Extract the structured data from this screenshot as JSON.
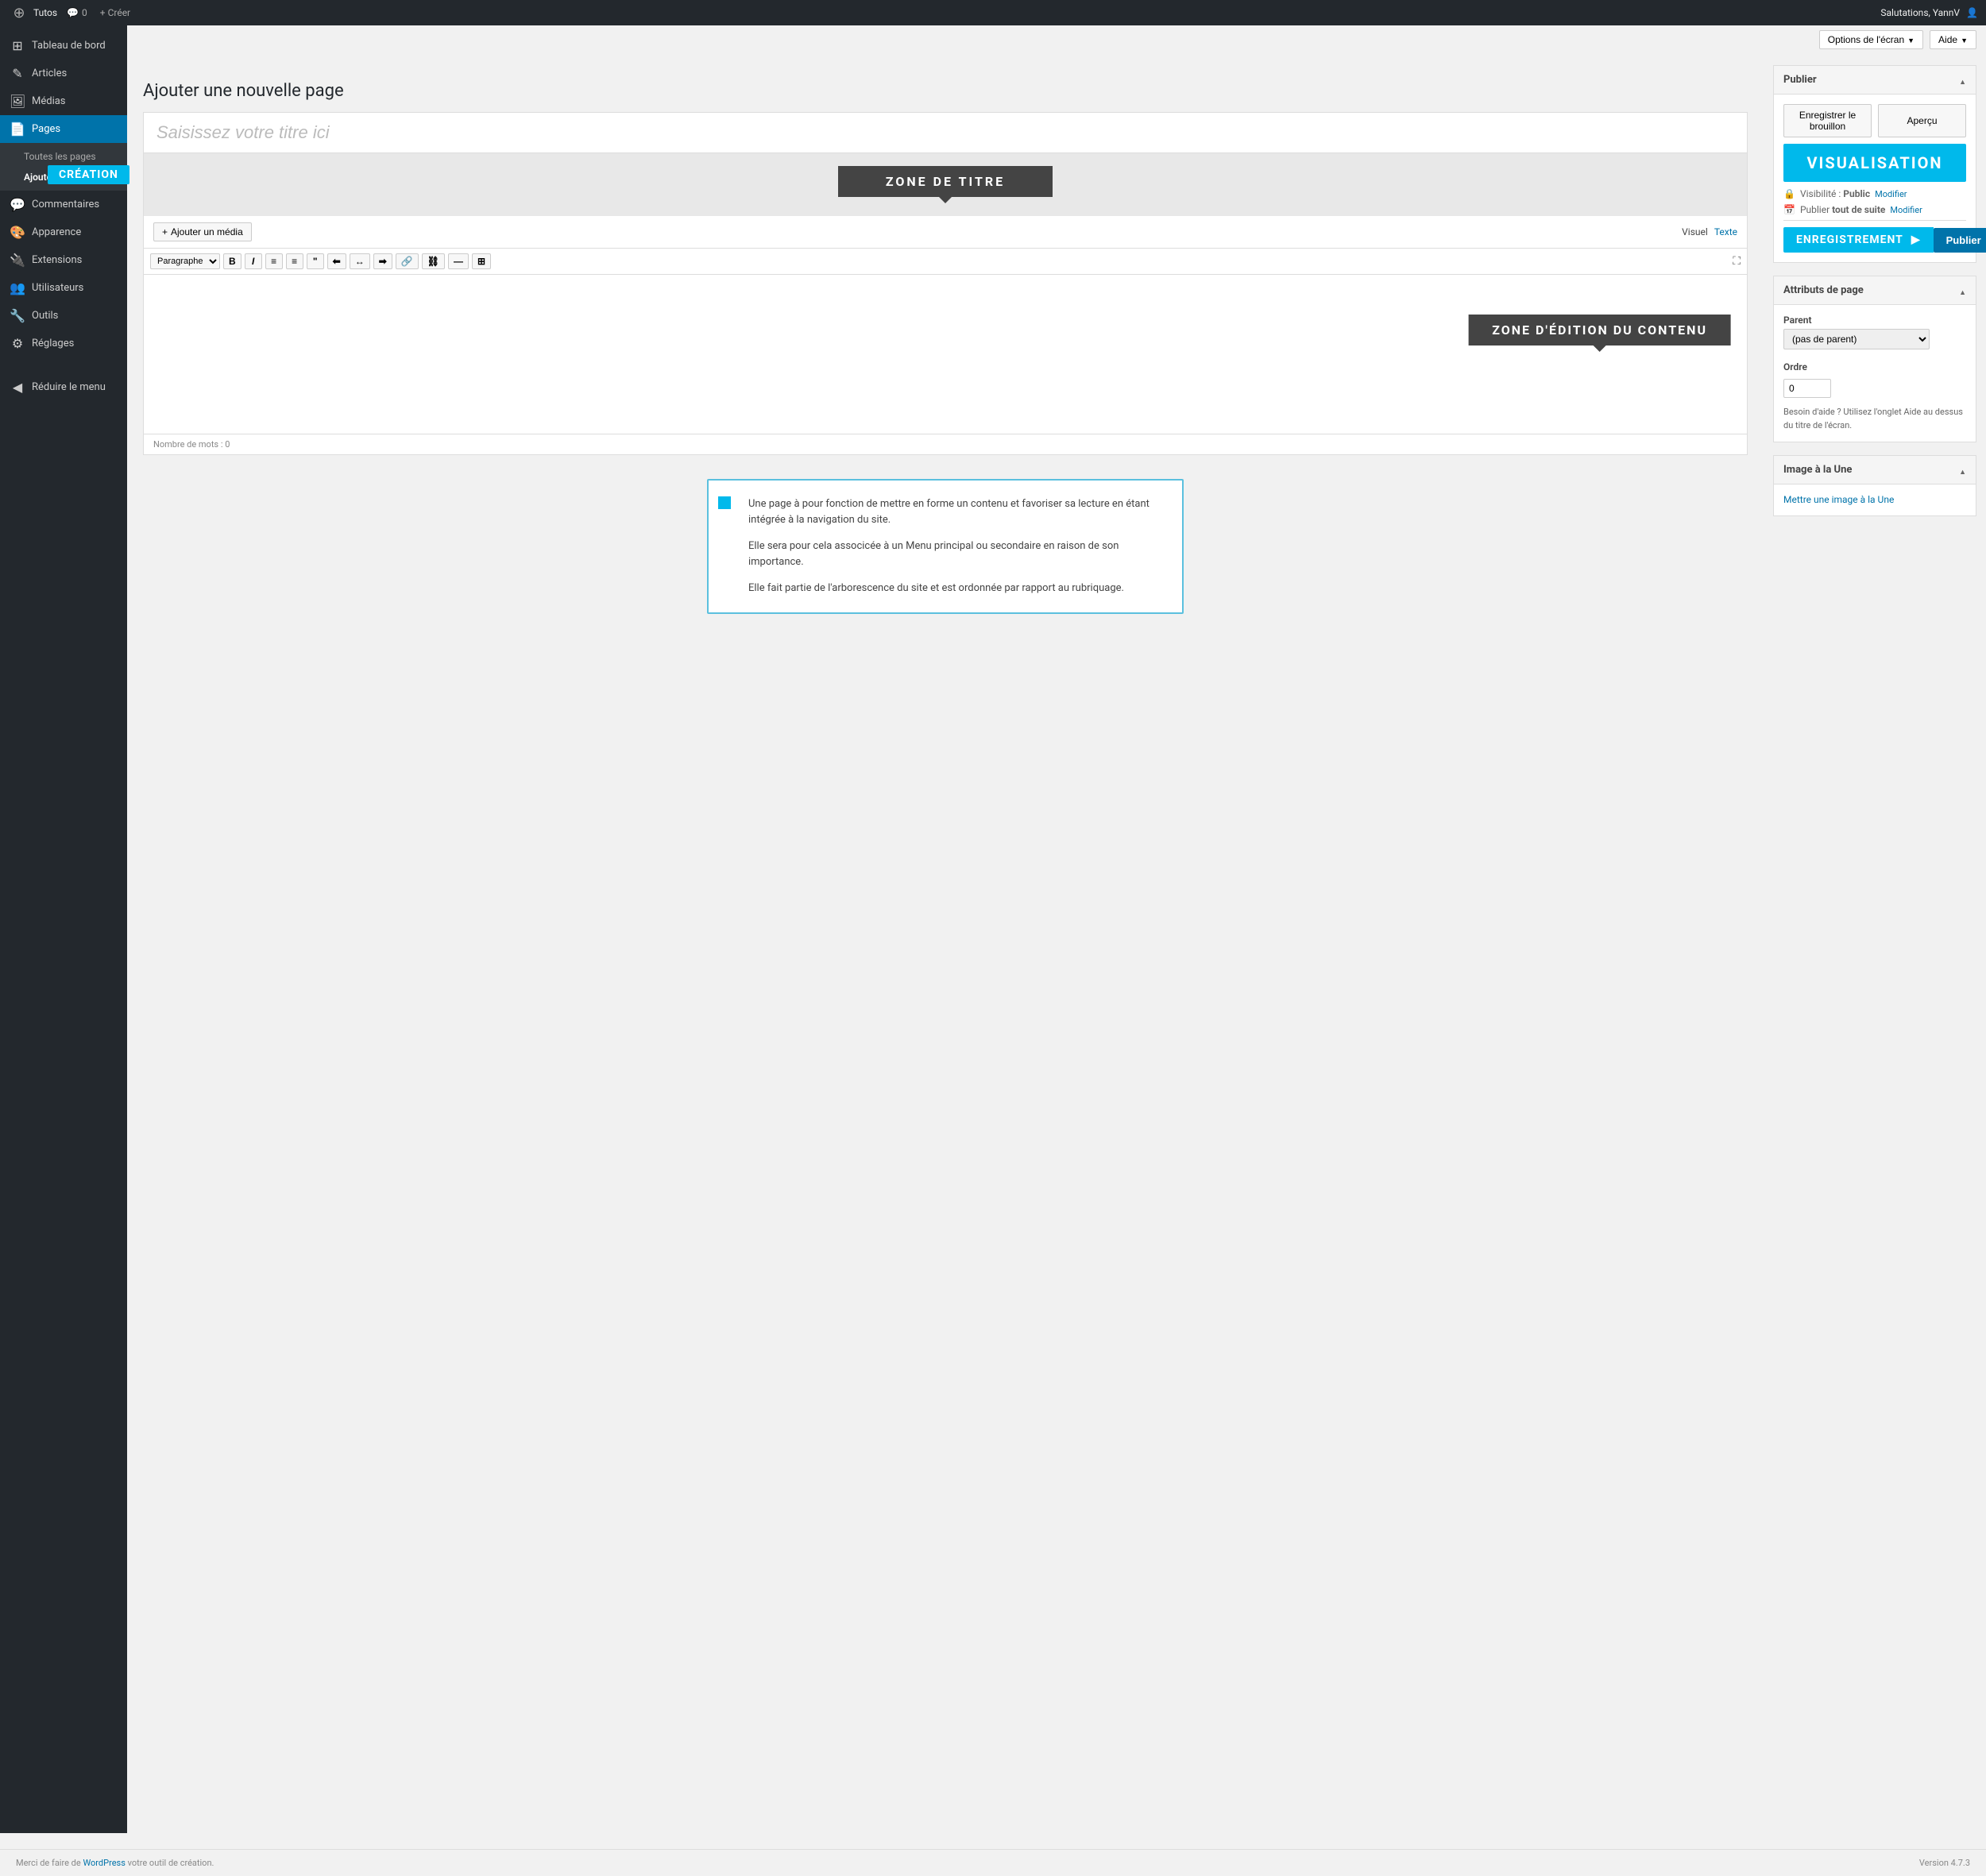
{
  "topbar": {
    "wp_logo": "⊕",
    "site_name": "Tutos",
    "comment_count": "0",
    "create_label": "+ Créer",
    "greeting": "Salutations, YannV",
    "user_icon": "👤"
  },
  "screen_options": {
    "options_label": "Options de l'écran",
    "help_label": "Aide"
  },
  "sidebar": {
    "items": [
      {
        "id": "dashboard",
        "label": "Tableau de bord",
        "icon": "⊞"
      },
      {
        "id": "articles",
        "label": "Articles",
        "icon": "✎"
      },
      {
        "id": "medias",
        "label": "Médias",
        "icon": "🖼"
      },
      {
        "id": "pages",
        "label": "Pages",
        "icon": "📄",
        "active": true
      },
      {
        "id": "commentaires",
        "label": "Commentaires",
        "icon": "💬"
      },
      {
        "id": "apparence",
        "label": "Apparence",
        "icon": "🎨"
      },
      {
        "id": "extensions",
        "label": "Extensions",
        "icon": "🔌"
      },
      {
        "id": "utilisateurs",
        "label": "Utilisateurs",
        "icon": "👥"
      },
      {
        "id": "outils",
        "label": "Outils",
        "icon": "🔧"
      },
      {
        "id": "reglages",
        "label": "Réglages",
        "icon": "⚙"
      },
      {
        "id": "reduire",
        "label": "Réduire le menu",
        "icon": "◀"
      }
    ],
    "sub_pages": [
      {
        "id": "toutes",
        "label": "Toutes les pages"
      },
      {
        "id": "ajouter",
        "label": "Ajouter",
        "active": true
      }
    ],
    "creation_badge": "CRÉATION"
  },
  "page": {
    "title": "Ajouter une nouvelle page",
    "title_placeholder": "Saisissez votre titre ici",
    "zone_titre_label": "ZONE DE TITRE",
    "zone_edition_label": "ZONE D'ÉDITION DU CONTENU",
    "add_media_btn": "Ajouter un média",
    "view_visual": "Visuel",
    "view_text": "Texte",
    "word_count": "Nombre de mots : 0"
  },
  "toolbar": {
    "format_select": "Paragraphe",
    "bold": "B",
    "italic": "I",
    "ul": "≡",
    "ol": "≡",
    "blockquote": "❝",
    "align_left": "⬤",
    "align_center": "⬤",
    "align_right": "⬤",
    "link": "🔗",
    "unlink": "⛓",
    "hr": "—",
    "table": "⊞",
    "expand": "⛶"
  },
  "publier": {
    "title": "Publier",
    "btn_draft": "Enregistrer le brouillon",
    "btn_apercu": "Aperçu",
    "visualisation_label": "VISUALISATION",
    "visibility_label": "Visibilité :",
    "visibility_value": "Public",
    "visibility_modify": "Modifier",
    "publish_label": "Publier",
    "publish_when": "tout de suite",
    "publish_modify": "Modifier",
    "enregistrement_label": "ENREGISTREMENT",
    "btn_publier": "Publier"
  },
  "attributs": {
    "title": "Attributs de page",
    "parent_label": "Parent",
    "parent_value": "(pas de parent)",
    "order_label": "Ordre",
    "order_value": "0",
    "help_text": "Besoin d'aide ? Utilisez l'onglet Aide au dessus du titre de l'écran."
  },
  "image_une": {
    "title": "Image à la Une",
    "link_label": "Mettre une image à la Une"
  },
  "info_box": {
    "para1": "Une page à pour fonction de mettre en forme un contenu et favoriser sa lecture en étant intégrée à la navigation du site.",
    "para2": "Elle sera pour cela associcée à un Menu principal ou secondaire en raison de son importance.",
    "para3": "Elle fait partie de l'arborescence du site et est ordonnée par rapport au rubriquage."
  },
  "footer": {
    "text": "Merci de faire de",
    "link_text": "WordPress",
    "text2": "votre outil de création.",
    "version": "Version 4.7.3"
  }
}
